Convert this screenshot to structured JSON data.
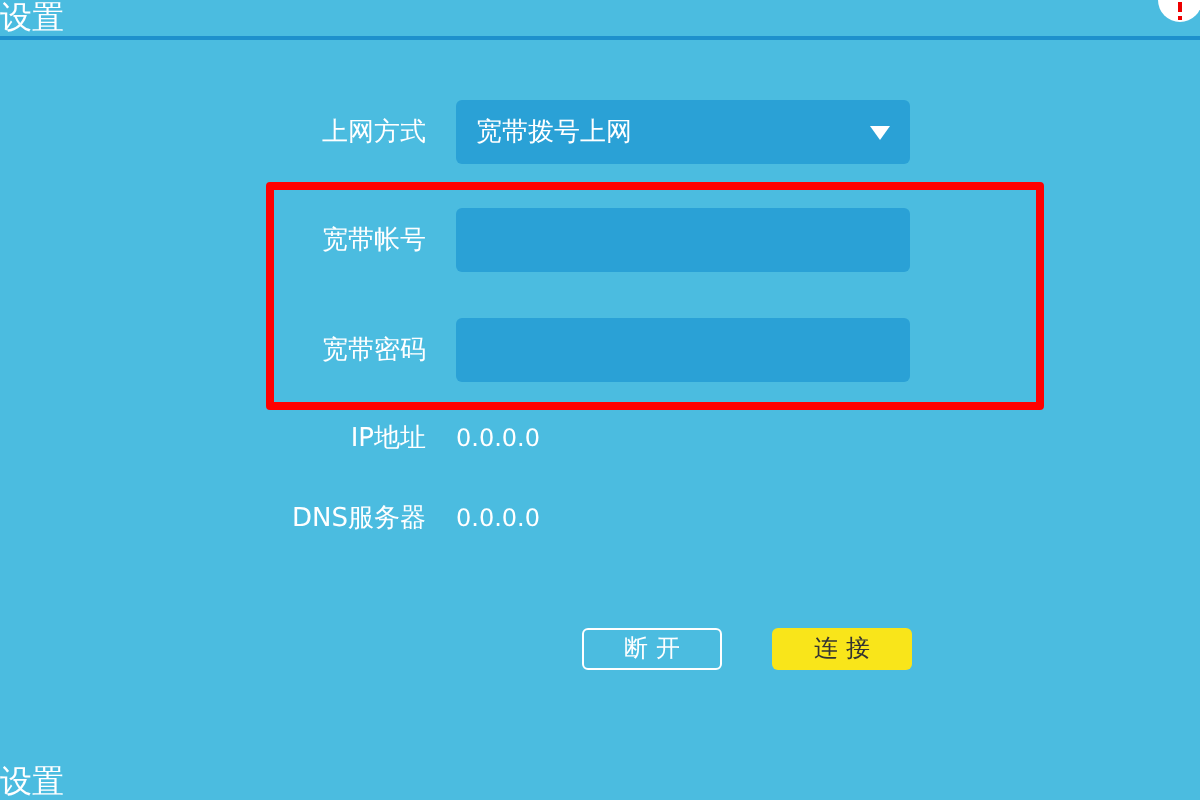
{
  "header": {
    "title": "设置"
  },
  "form": {
    "fields": [
      {
        "kind": "select",
        "label": "上网方式",
        "value": "宽带拨号上网",
        "highlighted": false
      },
      {
        "kind": "input",
        "label": "宽带帐号",
        "highlighted": true
      },
      {
        "kind": "input",
        "label": "宽带密码",
        "highlighted": true
      },
      {
        "kind": "info",
        "label": "IP地址",
        "value": "0.0.0.0",
        "highlighted": false
      },
      {
        "kind": "info",
        "label": "DNS服务器",
        "value": "0.0.0.0",
        "highlighted": false
      }
    ],
    "buttons": [
      {
        "kind": "outline",
        "label": "断 开"
      },
      {
        "kind": "primary",
        "label": "连 接"
      }
    ]
  },
  "next_section": {
    "title": "设置"
  }
}
